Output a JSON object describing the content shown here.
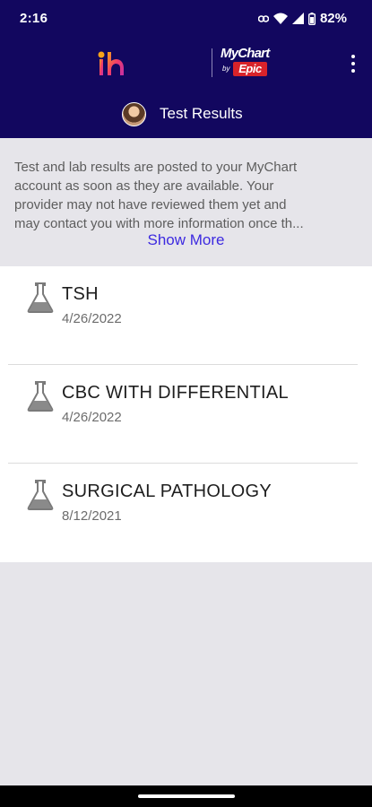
{
  "status_bar": {
    "time": "2:16",
    "battery": "82%"
  },
  "header": {
    "brand_top": "MyChart",
    "brand_by": "by",
    "brand_epic": "Epic",
    "title": "Test Results"
  },
  "notice": {
    "lines": [
      "Test and lab results are posted to your MyChart",
      "account as soon as they are available. Your",
      "provider may not have reviewed them yet and",
      "may contact you with more information once th..."
    ],
    "show_more": "Show More"
  },
  "results": [
    {
      "name": "TSH",
      "date": "4/26/2022"
    },
    {
      "name": "CBC WITH DIFFERENTIAL",
      "date": "4/26/2022"
    },
    {
      "name": "SURGICAL PATHOLOGY",
      "date": "8/12/2021"
    }
  ],
  "colors": {
    "header_bg": "#12075f",
    "link": "#3d2ae0",
    "background": "#e6e5ea"
  },
  "icons": {
    "wifi": "wifi-icon",
    "signal": "signal-icon",
    "battery": "battery-icon",
    "lab": "flask-icon",
    "menu": "more-vertical-icon"
  }
}
